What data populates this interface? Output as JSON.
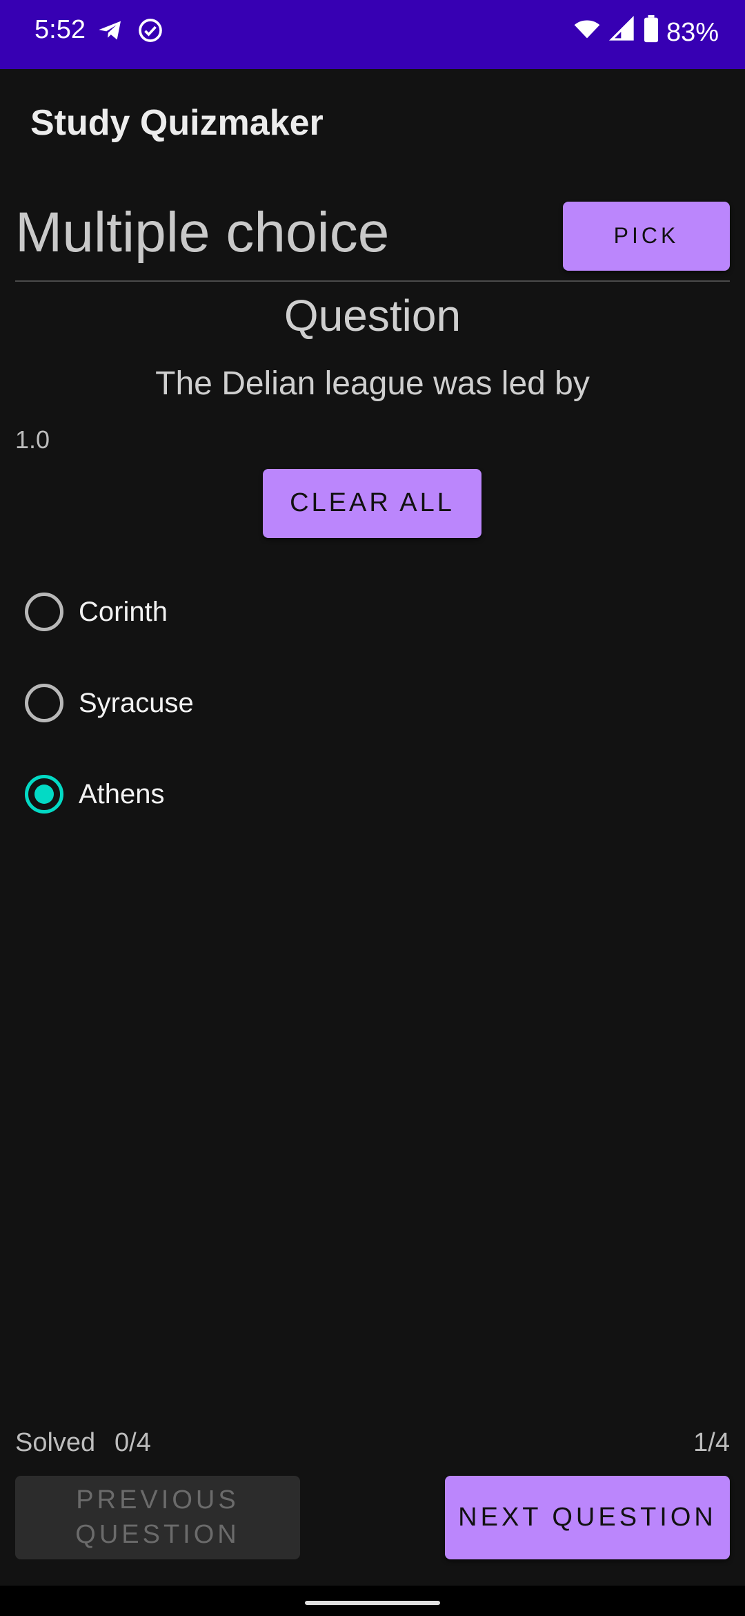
{
  "status_bar": {
    "time": "5:52",
    "battery": "83%",
    "left_icons": [
      "telegram-icon",
      "check-circle-icon"
    ],
    "right_icons": [
      "wifi-icon",
      "signal-icon",
      "battery-icon"
    ]
  },
  "app_bar": {
    "title": "Study Quizmaker"
  },
  "mode": {
    "title": "Multiple choice",
    "pick_label": "PICK"
  },
  "question": {
    "heading": "Question",
    "text": "The Delian league was led by",
    "weight": "1.0",
    "clear_all_label": "CLEAR ALL",
    "options": [
      {
        "label": "Corinth",
        "selected": false
      },
      {
        "label": "Syracuse",
        "selected": false
      },
      {
        "label": "Athens",
        "selected": true
      }
    ]
  },
  "footer": {
    "solved_label": "Solved",
    "solved_value": "0/4",
    "counter": "1/4",
    "previous_label": "PREVIOUS QUESTION",
    "next_label": "NEXT QUESTION"
  },
  "colors": {
    "status_bar": "#3700b3",
    "accent": "#bb86fc",
    "radio_selected": "#03dac5",
    "background": "#121212"
  }
}
